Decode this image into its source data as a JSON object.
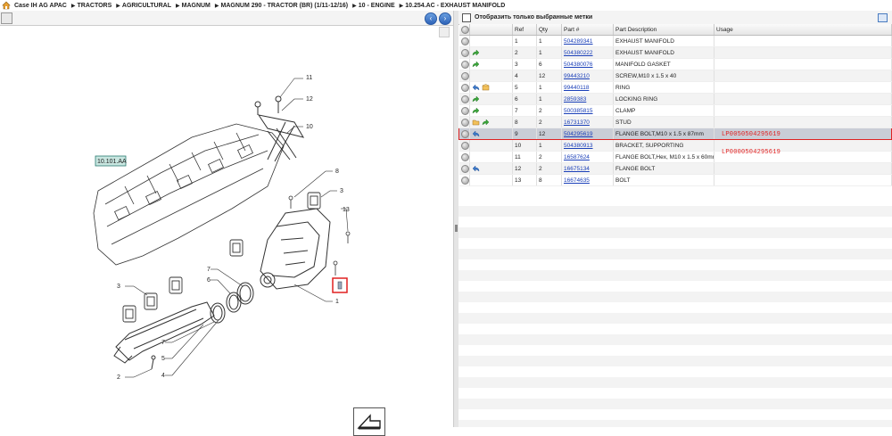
{
  "breadcrumb": [
    "Case IH AG APAC",
    "TRACTORS",
    "AGRICULTURAL",
    "MAGNUM",
    "MAGNUM 290 - TRACTOR (BR) (1/11-12/16)",
    "10 - ENGINE",
    "10.254.AC - EXHAUST MANIFOLD"
  ],
  "diagram": {
    "ref_label": "10.101.AA",
    "callouts": [
      "11",
      "12",
      "10",
      "8",
      "3",
      "13",
      "7",
      "6",
      "3",
      "1",
      "7",
      "5",
      "4",
      "2"
    ]
  },
  "filter": {
    "label": "Отобразить только выбранные метки"
  },
  "table": {
    "headers": [
      "",
      "",
      "Ref",
      "Qty",
      "Part #",
      "Part Description",
      "Usage"
    ],
    "rows": [
      {
        "ref": "1",
        "qty": "1",
        "part": "504289341",
        "desc": "EXHAUST MANIFOLD",
        "icons": []
      },
      {
        "ref": "2",
        "qty": "1",
        "part": "504380222",
        "desc": "EXHAUST MANIFOLD",
        "icons": [
          "green-arrow-icon"
        ]
      },
      {
        "ref": "3",
        "qty": "6",
        "part": "504380076",
        "desc": "MANIFOLD GASKET",
        "icons": [
          "green-arrow-icon"
        ]
      },
      {
        "ref": "4",
        "qty": "12",
        "part": "99443210",
        "desc": "SCREW,M10 x 1.5 x 40",
        "icons": []
      },
      {
        "ref": "5",
        "qty": "1",
        "part": "99440118",
        "desc": "RING",
        "icons": [
          "blue-arrow-icon",
          "box-icon"
        ]
      },
      {
        "ref": "6",
        "qty": "1",
        "part": "2859383",
        "desc": "LOCKING RING",
        "icons": [
          "green-arrow-icon"
        ]
      },
      {
        "ref": "7",
        "qty": "2",
        "part": "500385815",
        "desc": "CLAMP",
        "icons": [
          "green-arrow-icon"
        ]
      },
      {
        "ref": "8",
        "qty": "2",
        "part": "16731370",
        "desc": "STUD",
        "icons": [
          "folder-icon",
          "green-arrow-icon"
        ]
      },
      {
        "ref": "9",
        "qty": "12",
        "part": "504295619",
        "desc": "FLANGE BOLT,M10 x 1.5 x 87mm",
        "icons": [
          "blue-arrow-icon"
        ],
        "highlight": true
      },
      {
        "ref": "10",
        "qty": "1",
        "part": "504380913",
        "desc": "BRACKET, SUPPORTING",
        "icons": []
      },
      {
        "ref": "11",
        "qty": "2",
        "part": "16587624",
        "desc": "FLANGE BOLT,Hex, M10 x 1.5 x 60mm",
        "icons": []
      },
      {
        "ref": "12",
        "qty": "2",
        "part": "16675134",
        "desc": "FLANGE BOLT",
        "icons": [
          "blue-arrow-icon"
        ]
      },
      {
        "ref": "13",
        "qty": "8",
        "part": "16674635",
        "desc": "BOLT",
        "icons": []
      }
    ]
  },
  "annotations": [
    "LP0050504295619",
    "LP0000504295619"
  ],
  "colors": {
    "highlight_border": "#d22222",
    "link": "#1a3fb8",
    "annotation": "#e02020"
  }
}
